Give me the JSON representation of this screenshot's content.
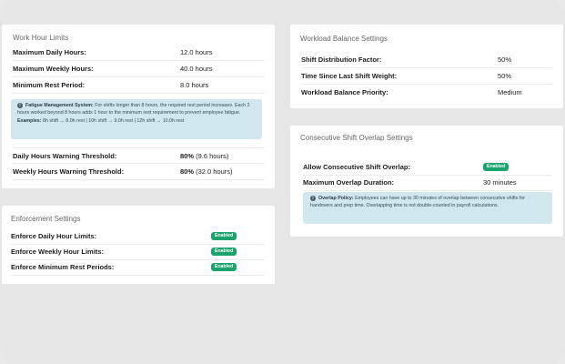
{
  "work_hour_limits": {
    "title": "Work Hour Limits",
    "rows": [
      {
        "label": "Maximum Daily Hours:",
        "value": "12.0 hours"
      },
      {
        "label": "Maximum Weekly Hours:",
        "value": "40.0 hours"
      },
      {
        "label": "Minimum Rest Period:",
        "value": "8.0 hours"
      }
    ],
    "fatigue_note": {
      "title": "Fatigue Management System:",
      "text": "For shifts longer than 8 hours, the required rest period increases. Each 2 hours worked beyond 8 hours adds 1 hour to the minimum rest requirement to prevent employee fatigue.",
      "examples_label": "Examples:",
      "examples_text": "8h shift → 8.0h rest | 10h shift → 9.0h rest | 12h shift → 10.0h rest"
    },
    "warnings": [
      {
        "label": "Daily Hours Warning Threshold:",
        "value": "80%",
        "extra": "(9.6 hours)"
      },
      {
        "label": "Weekly Hours Warning Threshold:",
        "value": "80%",
        "extra": "(32.0 hours)"
      }
    ]
  },
  "enforcement": {
    "title": "Enforcement Settings",
    "rows": [
      {
        "label": "Enforce Daily Hour Limits:",
        "status": "Enabled"
      },
      {
        "label": "Enforce Weekly Hour Limits:",
        "status": "Enabled"
      },
      {
        "label": "Enforce Minimum Rest Periods:",
        "status": "Enabled"
      }
    ]
  },
  "workload_balance": {
    "title": "Workload Balance Settings",
    "rows": [
      {
        "label": "Shift Distribution Factor:",
        "value": "50%"
      },
      {
        "label": "Time Since Last Shift Weight:",
        "value": "50%"
      },
      {
        "label": "Workload Balance Priority:",
        "value": "Medium"
      }
    ]
  },
  "overlap": {
    "title": "Consecutive Shift Overlap Settings",
    "rows": [
      {
        "label": "Allow Consecutive Shift Overlap:",
        "status": "Enabled"
      },
      {
        "label": "Maximum Overlap Duration:",
        "value": "30 minutes"
      }
    ],
    "note": {
      "title": "Overlap Policy:",
      "text": "Employees can have up to 30 minutes of overlap between consecutive shifts for handovers and prep time. Overlapping time is not double-counted in payroll calculations."
    }
  },
  "colors": {
    "enabled_badge": "#1aa36a",
    "note_background": "#cfe7ed"
  }
}
